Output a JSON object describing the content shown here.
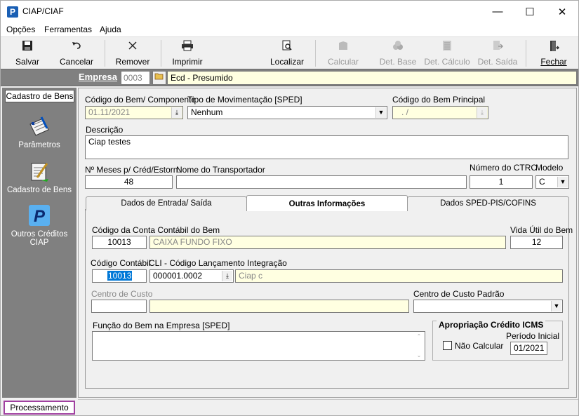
{
  "window": {
    "title": "CIAP/CIAF",
    "app_icon_letter": "P",
    "minimize": "—",
    "maximize": "☐",
    "close": "✕"
  },
  "menu": [
    "Opções",
    "Ferramentas",
    "Ajuda"
  ],
  "toolbar": {
    "salvar": "Salvar",
    "cancelar": "Cancelar",
    "remover": "Remover",
    "imprimir": "Imprimir",
    "localizar": "Localizar",
    "calcular": "Calcular",
    "det_base": "Det. Base",
    "det_calculo": "Det. Cálculo",
    "det_saida": "Det. Saída",
    "fechar": "Fechar"
  },
  "empresa": {
    "label": "Empresa",
    "code": "0003",
    "name": "Ecd - Presumido"
  },
  "sidebar": {
    "tab": "Cadastro de Bens",
    "items": [
      "Parâmetros",
      "Cadastro de Bens",
      "Outros Créditos CIAP"
    ],
    "processamento": "Processamento"
  },
  "form": {
    "codigo_bem_label": "Código do Bem/ Componente",
    "codigo_bem_value": "01.11/2021",
    "tipo_mov_label": "Tipo de Movimentação [SPED]",
    "tipo_mov_value": "Nenhum",
    "codigo_principal_label": "Código do Bem Principal",
    "codigo_principal_value": ". /",
    "descricao_label": "Descrição",
    "descricao_value": "Ciap testes",
    "meses_label": "Nº Meses p/ Créd/Estorn.",
    "meses_value": "48",
    "transportador_label": "Nome do Transportador",
    "transportador_value": "",
    "ctrc_label": "Número do CTRC",
    "ctrc_value": "1",
    "modelo_label": "Modelo",
    "modelo_value": "C"
  },
  "tabs": [
    "Dados de Entrada/ Saída",
    "Outras Informações",
    "Dados SPED-PIS/COFINS"
  ],
  "outras": {
    "conta_label": "Código da Conta Contábil do Bem",
    "conta_code": "10013",
    "conta_desc": "CAIXA FUNDO FIXO",
    "vida_label": "Vida Útil do Bem",
    "vida_value": "12",
    "cod_contabil_label": "Código Contábil",
    "cod_contabil_value": "10013",
    "cli_label": "CLI - Código Lançamento Integração",
    "cli_code": "000001.0002",
    "cli_desc": "Ciap c",
    "centro_custo_label": "Centro de Custo",
    "centro_custo_padrao_label": "Centro de Custo Padrão",
    "funcao_label": "Função do Bem na Empresa [SPED]",
    "apropriacao_title": "Apropriação Crédito ICMS",
    "nao_calcular": "Não Calcular",
    "periodo_label": "Período Inicial",
    "periodo_value": "01/2021"
  }
}
